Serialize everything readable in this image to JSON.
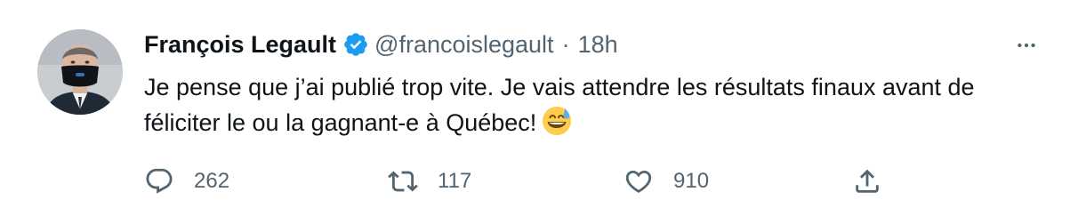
{
  "tweet": {
    "display_name": "François Legault",
    "handle": "@francoislegault",
    "separator": "·",
    "time": "18h",
    "text": "Je pense que j’ai publié trop vite. Je vais attendre les résultats finaux avant de féliciter le ou la gagnant-e à Québec!",
    "emoji": "grinning-face-with-sweat",
    "verified": true
  },
  "actions": {
    "replies": "262",
    "retweets": "117",
    "likes": "910"
  },
  "icons": {
    "more": "more-horizontal-icon",
    "reply": "reply-icon",
    "retweet": "retweet-icon",
    "like": "heart-icon",
    "share": "share-icon",
    "verified": "verified-badge-icon"
  },
  "colors": {
    "text": "#0f1419",
    "secondary": "#536471",
    "verified": "#1d9bf0",
    "background": "#ffffff"
  }
}
